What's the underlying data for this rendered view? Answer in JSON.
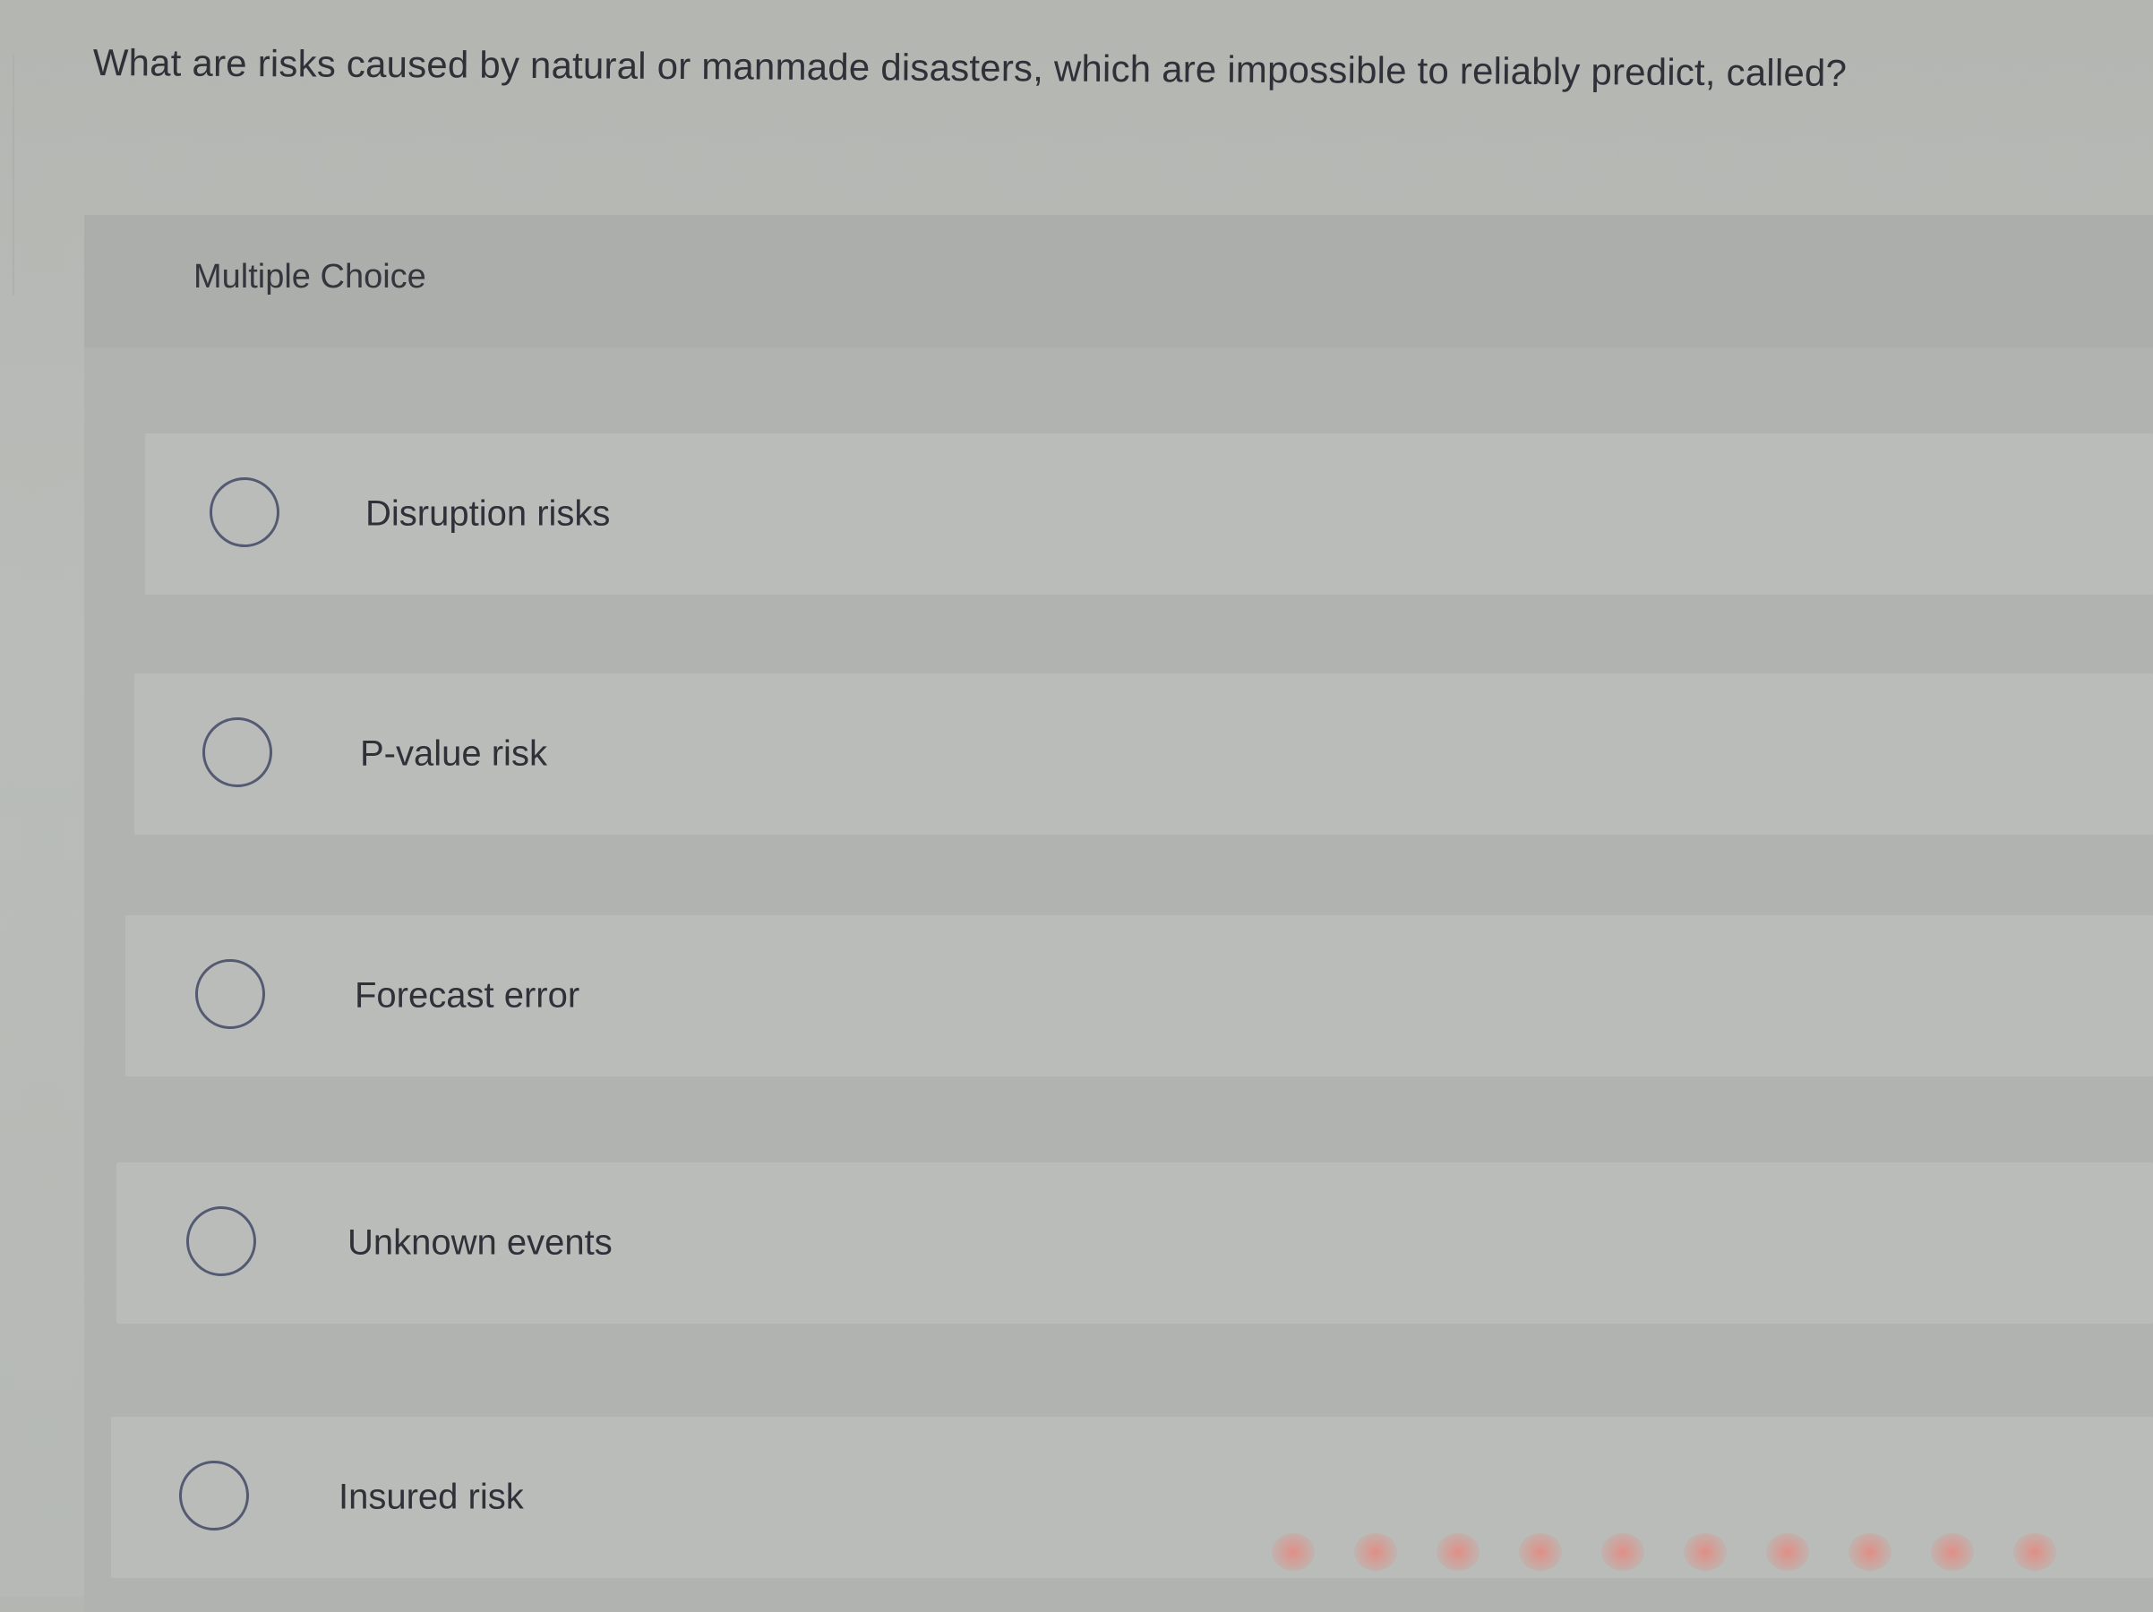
{
  "question": {
    "text": "What are risks caused by natural or manmade disasters, which are impossible to reliably predict, called?"
  },
  "question_type": "Multiple Choice",
  "options": [
    {
      "label": "Disruption risks",
      "selected": false
    },
    {
      "label": "P-value risk",
      "selected": false
    },
    {
      "label": "Forecast error",
      "selected": false
    },
    {
      "label": "Unknown events",
      "selected": false
    },
    {
      "label": "Insured risk",
      "selected": false
    }
  ],
  "colors": {
    "background": "#b6b9b5",
    "card": "#b0b3af",
    "option_bg": "#b9bcb8",
    "radio_border": "#545a72",
    "text": "#2f3139"
  }
}
